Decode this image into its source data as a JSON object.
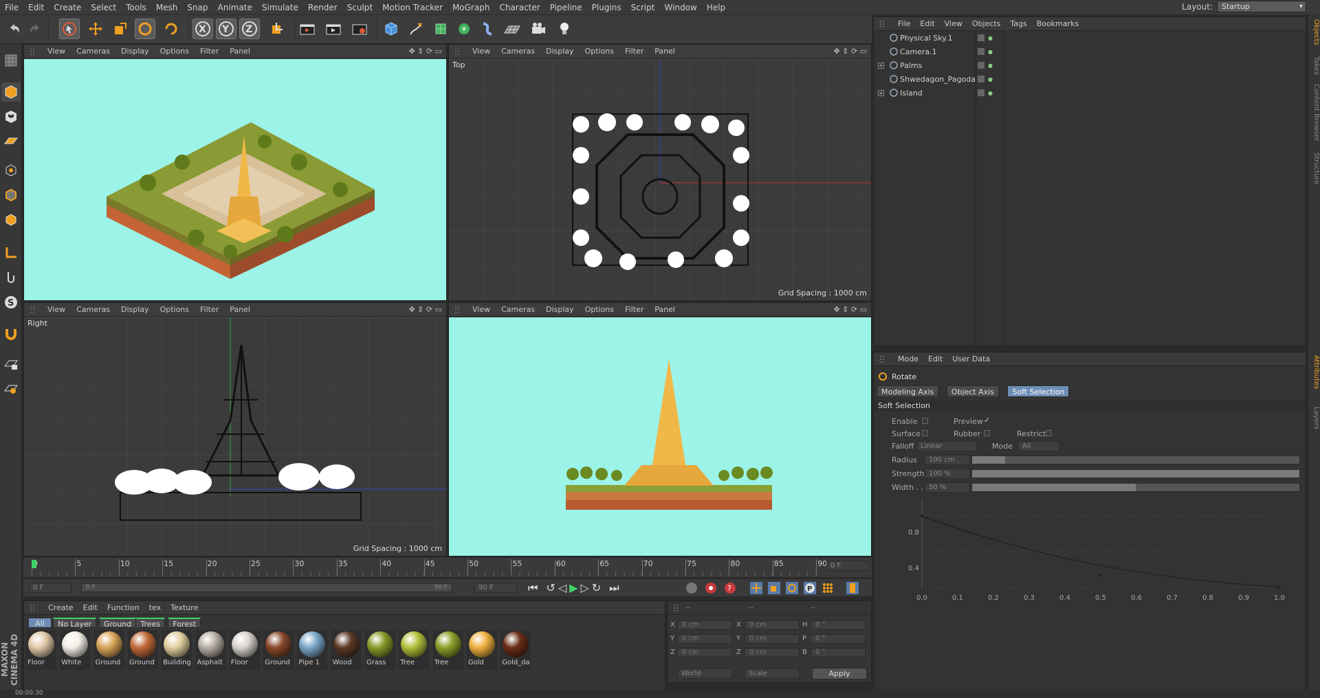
{
  "menubar": {
    "items": [
      "File",
      "Edit",
      "Create",
      "Select",
      "Tools",
      "Mesh",
      "Snap",
      "Animate",
      "Simulate",
      "Render",
      "Sculpt",
      "Motion Tracker",
      "MoGraph",
      "Character",
      "Pipeline",
      "Plugins",
      "Script",
      "Window",
      "Help"
    ],
    "layout_label": "Layout:",
    "layout_value": "Startup"
  },
  "viewport_menu": [
    "View",
    "Cameras",
    "Display",
    "Options",
    "Filter",
    "Panel"
  ],
  "viewports": {
    "top_label": "Top",
    "right_label": "Right",
    "grid_spacing": "Grid Spacing : 1000 cm"
  },
  "object_manager": {
    "menu": [
      "File",
      "Edit",
      "View",
      "Objects",
      "Tags",
      "Bookmarks"
    ],
    "objects": [
      {
        "name": "Physical Sky.1",
        "expand": ""
      },
      {
        "name": "Camera.1",
        "expand": ""
      },
      {
        "name": "Palms",
        "expand": "+"
      },
      {
        "name": "Shwedagon_Pagoda",
        "expand": ""
      },
      {
        "name": "Island",
        "expand": "+"
      }
    ]
  },
  "attribute_manager": {
    "menu": [
      "Mode",
      "Edit",
      "User Data"
    ],
    "tool_name": "Rotate",
    "tabs": [
      "Modeling Axis",
      "Object Axis",
      "Soft Selection"
    ],
    "active_tab": "Soft Selection",
    "section": "Soft Selection",
    "enable_label": "Enable",
    "preview_label": "Preview",
    "preview_check": "✓",
    "surface_label": "Surface",
    "rubber_label": "Rubber",
    "restrict_label": "Restrict",
    "falloff_label": "Falloff",
    "falloff_value": "Linear",
    "mode_label": "Mode",
    "mode_value": "All",
    "radius_label": "Radius",
    "radius_value": "100 cm",
    "radius_fill": 0.1,
    "strength_label": "Strength",
    "strength_value": "100 %",
    "strength_fill": 1.0,
    "width_label": "Width . .",
    "width_value": "50 %",
    "width_fill": 0.5,
    "graph_y_labels": [
      "0.8",
      "0.4"
    ],
    "graph_x_labels": [
      "0.0",
      "0.1",
      "0.2",
      "0.3",
      "0.4",
      "0.5",
      "0.6",
      "0.7",
      "0.8",
      "0.9",
      "1.0"
    ],
    "right_tabs": [
      "Objects",
      "Takes",
      "Content Browser",
      "Structure"
    ],
    "right_tabs2": [
      "Attributes",
      "Layers"
    ]
  },
  "timeline": {
    "ticks": [
      "0",
      "5",
      "10",
      "15",
      "20",
      "25",
      "30",
      "35",
      "40",
      "45",
      "50",
      "55",
      "60",
      "65",
      "70",
      "75",
      "80",
      "85",
      "90"
    ],
    "current_frame": "0 F",
    "start_field": "0 F",
    "range_left": "0 F",
    "range_right": "90 F",
    "end_field": "90 F"
  },
  "material_manager": {
    "menu": [
      "Create",
      "Edit",
      "Function",
      "tex",
      "Texture"
    ],
    "filters": [
      "All",
      "No Layer",
      "Ground",
      "Trees",
      "Forest"
    ],
    "materials": [
      {
        "name": "Floor",
        "color": "#e0c8a8"
      },
      {
        "name": "White",
        "color": "#f2efe6"
      },
      {
        "name": "Ground",
        "color": "#d9a458"
      },
      {
        "name": "Ground",
        "color": "#c26a3a"
      },
      {
        "name": "Building",
        "color": "#e0cfa0"
      },
      {
        "name": "Asphalt",
        "color": "#b8aea6"
      },
      {
        "name": "Floor",
        "color": "#d6d2cc"
      },
      {
        "name": "Ground",
        "color": "#8a4a2c"
      },
      {
        "name": "Pipe 1",
        "color": "#7aa7c7"
      },
      {
        "name": "Wood",
        "color": "#5c3a26"
      },
      {
        "name": "Grass",
        "color": "#8a9a2a"
      },
      {
        "name": "Tree",
        "color": "#b2c03a"
      },
      {
        "name": "Tree",
        "color": "#8e9e2a"
      },
      {
        "name": "Gold",
        "color": "#f0b040"
      },
      {
        "name": "Gold_da",
        "color": "#6a2e16"
      }
    ]
  },
  "coordinate_manager": {
    "headers": [
      "--",
      "--",
      "--"
    ],
    "rows": [
      {
        "a": "X",
        "av": "0 cm",
        "b": "X",
        "bv": "0 cm",
        "c": "H",
        "cv": "0 °"
      },
      {
        "a": "Y",
        "av": "0 cm",
        "b": "Y",
        "bv": "0 cm",
        "c": "P",
        "cv": "0 °"
      },
      {
        "a": "Z",
        "av": "0 cm",
        "b": "Z",
        "bv": "0 cm",
        "c": "B",
        "cv": "0 °"
      }
    ],
    "world": "World",
    "scale": "Scale",
    "apply": "Apply"
  },
  "status": {
    "time": "00:00:30",
    "brand": "MAXON CINEMA 4D"
  },
  "colors": {
    "sky": "#9cf3e8",
    "accent": "#6e8db5",
    "timeline_marker": "#3fd46a"
  }
}
